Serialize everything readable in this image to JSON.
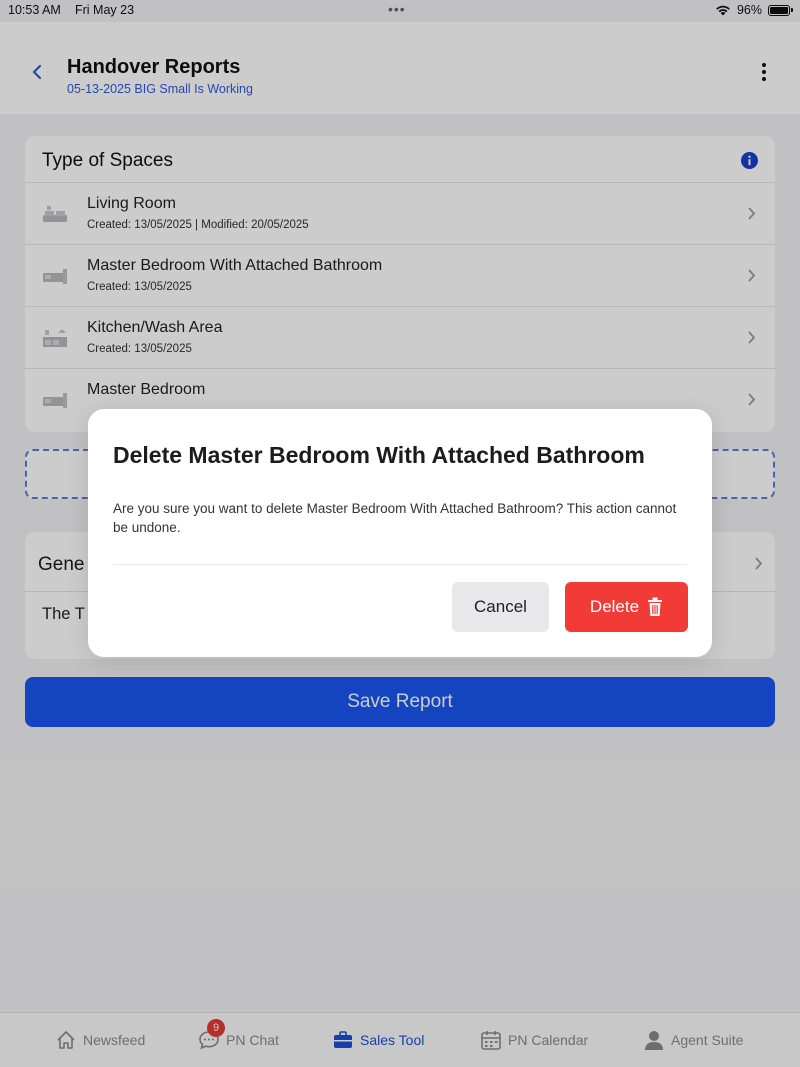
{
  "status_bar": {
    "time": "10:53 AM",
    "date": "Fri May 23",
    "dots": "•••",
    "battery": "96%"
  },
  "header": {
    "title": "Handover Reports",
    "subtitle": "05-13-2025 BIG Small Is Working",
    "back_icon": "chevron-left-icon",
    "more_icon": "more-vertical-icon"
  },
  "spaces": {
    "title": "Type of Spaces",
    "info_icon": "info-icon",
    "items": [
      {
        "name": "Living Room",
        "meta": "Created: 13/05/2025 | Modified: 20/05/2025",
        "icon": "sofa-icon"
      },
      {
        "name": "Master Bedroom With Attached Bathroom",
        "meta": "Created: 13/05/2025",
        "icon": "bed-icon"
      },
      {
        "name": "Kitchen/Wash Area",
        "meta": "Created: 13/05/2025",
        "icon": "kitchen-icon"
      },
      {
        "name": "Master Bedroom",
        "meta": "",
        "icon": "bed-icon"
      }
    ]
  },
  "general": {
    "title": "Gene",
    "text": "The T"
  },
  "save_button": "Save Report",
  "modal": {
    "title": "Delete Master Bedroom With Attached Bathroom",
    "message": "Are you sure you want to delete Master Bedroom With Attached Bathroom? This action cannot be undone.",
    "cancel_label": "Cancel",
    "delete_label": "Delete",
    "delete_color": "#f23b36"
  },
  "tabbar": {
    "items": [
      {
        "label": "Newsfeed",
        "icon": "home-icon"
      },
      {
        "label": "PN Chat",
        "icon": "chat-icon",
        "badge": "9"
      },
      {
        "label": "Sales Tool",
        "icon": "briefcase-icon",
        "active": true
      },
      {
        "label": "PN Calendar",
        "icon": "calendar-icon"
      },
      {
        "label": "Agent Suite",
        "icon": "person-icon"
      }
    ]
  },
  "colors": {
    "accent": "#1a56f0",
    "danger": "#f23b36",
    "link": "#2f5bd6"
  }
}
